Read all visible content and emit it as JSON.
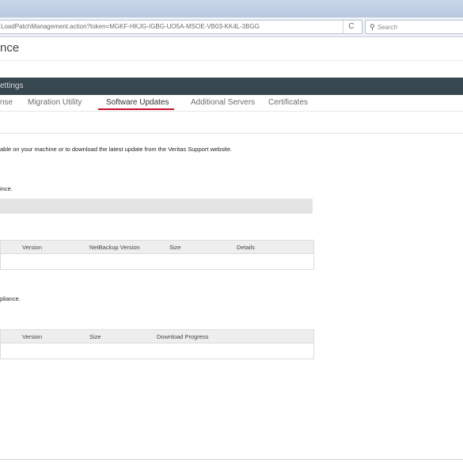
{
  "browser": {
    "url": "LoadPatchManagement.action?token=MGKF-HKJG-IGBG-UO5A-MSOE-VB03-KK4L-3BGG",
    "reload_glyph": "C",
    "search_placeholder": "Search",
    "search_icon": "search-icon",
    "reload_icon": "reload-icon"
  },
  "page": {
    "title": "nce"
  },
  "settings_bar": {
    "label": "ettings"
  },
  "tabs": [
    {
      "label": "nse",
      "active": false
    },
    {
      "label": "Migration Utility",
      "active": false
    },
    {
      "label": "Software Updates",
      "active": true
    },
    {
      "label": "Additional Servers",
      "active": false
    },
    {
      "label": "Certificates",
      "active": false
    }
  ],
  "content": {
    "description": "able on your machine or to download the latest update from the Veritas Support website.",
    "section1_note": "ince.",
    "table1": {
      "headers": [
        "Version",
        "NetBackup Version",
        "Size",
        "Details"
      ]
    },
    "section2_note": "pliance.",
    "table2": {
      "headers": [
        "Version",
        "Size",
        "Download Progress"
      ]
    }
  },
  "colors": {
    "accent": "#c8102e",
    "header_bar": "#37474f"
  }
}
